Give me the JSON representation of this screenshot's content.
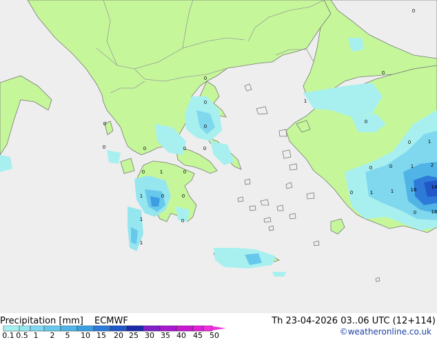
{
  "map": {
    "colors": {
      "sea": "#eeeeee",
      "land": "#c5f79a",
      "border": "#9a9a9a",
      "coast": "#777777",
      "value_label": "#000000"
    },
    "value_labels": [
      "0",
      "0",
      "0",
      "0",
      "0",
      "0",
      "0",
      "0",
      "0",
      "0",
      "0",
      "0",
      "0",
      "0",
      "0",
      "0",
      "1",
      "1",
      "1",
      "1",
      "1",
      "1",
      "1",
      "1",
      "1",
      "2",
      "16",
      "14",
      "16",
      "0",
      "0",
      "0",
      "0",
      "0"
    ]
  },
  "footer": {
    "title": "Precipitation [mm]",
    "model": "ECMWF",
    "datetime": "Th 23-04-2026 03..06 UTC (12+114)",
    "copyright": "©weatheronline.co.uk"
  },
  "legend": {
    "ticks": [
      "0.1",
      "0.5",
      "1",
      "2",
      "5",
      "10",
      "15",
      "20",
      "25",
      "30",
      "35",
      "40",
      "45",
      "50"
    ],
    "colors": [
      "#a8f0f0",
      "#96e6f0",
      "#7fd8ee",
      "#68c8ec",
      "#50b4e6",
      "#3c9ee0",
      "#2e7ad8",
      "#2258c8",
      "#1a2aa8",
      "#8020c8",
      "#a818d0",
      "#c818d0",
      "#e020d8",
      "#f030e0"
    ]
  }
}
